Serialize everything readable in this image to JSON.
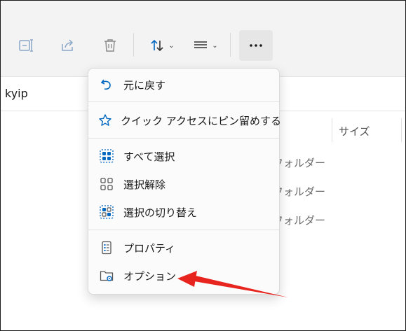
{
  "address": {
    "text": "kyip"
  },
  "file_list": {
    "size_header": "サイズ",
    "rows": [
      {
        "type": "フォルダー"
      },
      {
        "type": "フォルダー"
      },
      {
        "type": "フォルダー"
      }
    ]
  },
  "menu": {
    "items": [
      {
        "label": "元に戻す",
        "icon": "undo-icon"
      },
      {
        "label": "クイック アクセスにピン留めする",
        "icon": "star-icon"
      },
      {
        "label": "すべて選択",
        "icon": "select-all-icon"
      },
      {
        "label": "選択解除",
        "icon": "select-none-icon"
      },
      {
        "label": "選択の切り替え",
        "icon": "invert-selection-icon"
      },
      {
        "label": "プロパティ",
        "icon": "properties-icon"
      },
      {
        "label": "オプション",
        "icon": "folder-options-icon"
      }
    ]
  },
  "colors": {
    "accent": "#0067c0",
    "annotation_arrow": "#e8241f"
  }
}
